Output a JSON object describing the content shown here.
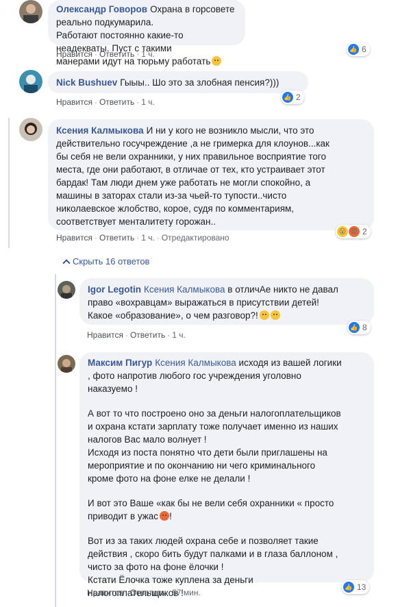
{
  "comments": [
    {
      "author": "Олександр Говоров",
      "lines": [
        "Охрана в горсовете реально подкумарила.",
        "Работают постоянно какие-то неадекваты. Пуст с такими",
        "манерами идут на тюрьму работать"
      ],
      "emoji": "😞",
      "actions": {
        "like": "Нравится",
        "reply": "Ответить",
        "time": "1 ч."
      },
      "reaction_count": "6"
    },
    {
      "author": "Nick Bushuev",
      "lines": [
        "Гыыы.. Шо это за злобная пенсия?)))"
      ],
      "actions": {
        "like": "Нравится",
        "reply": "Ответить",
        "time": "1 ч."
      },
      "reaction_count": "2"
    },
    {
      "author": "Ксения Калмыкова",
      "lines": [
        "И ни у кого не возникло мысли, что это",
        "действительно госучреждение ,а не гримерка для клоунов...как",
        "бы себя не вели охранники, у них правильное восприятие того",
        "места, где они работают, в отличае от тех, кто устраивает этот",
        "бардак! Там люди днем уже работать не могли спокойно, а",
        "машины в заторах стали из-за чьей-то тупости..чисто",
        "николаевское жлобство, корое, судя по комментариям,",
        "соответствует менталитету горожан.."
      ],
      "actions": {
        "like": "Нравится",
        "reply": "Ответить",
        "time": "1 ч.",
        "edited": "Отредактировано"
      },
      "reaction_count": "2"
    }
  ],
  "replies_toggle": "Скрыть 16 ответов",
  "replies": [
    {
      "author": "Igor Legotin",
      "mention": "Ксения Калмыкова",
      "lines": [
        "в отличАе никто не давал",
        "право «вохравцам» выражаться в присутствии детей!",
        "Какое «образование», о чем разговор?!"
      ],
      "actions": {
        "like": "Нравится",
        "reply": "Ответить",
        "time": "1 ч."
      },
      "reaction_count": "8"
    },
    {
      "author": "Максим Пигур",
      "mention": "Ксения Калмыкова",
      "lines": [
        "исходя из вашей логики",
        ", фото напротив любого гос учреждения уголовно",
        "наказуемо !",
        "",
        "А вот то что построено оно за деньги налогоплательщиков",
        "и охрана кстати зарплату тоже получает именно из наших",
        "налогов Вас мало волнует !",
        "Исходя из поста понятно что дети были приглашены на",
        "мероприятие и по окончанию ни чего криминального",
        "кроме фото на фоне елке не делали !",
        "",
        "И вот это Ваше «как бы не вели себя охранники « просто",
        "приводит в ужас",
        "",
        "Вот из за таких людей охрана себе и позволяет такие",
        "действия , скоро бить будут палками и в глаза баллоном ,",
        "чисто за фото на фоне ёлочки !",
        "Кстати Ёлочка тоже куплена за деньги",
        "налогоплательщиков !"
      ],
      "actions": {
        "like": "Нравится",
        "reply": "Ответить",
        "time": "57 мин."
      },
      "reaction_count": "13"
    }
  ],
  "colors": {
    "link": "#385898",
    "bubble": "#f0f2f5",
    "like_blue": "#2078f4"
  }
}
